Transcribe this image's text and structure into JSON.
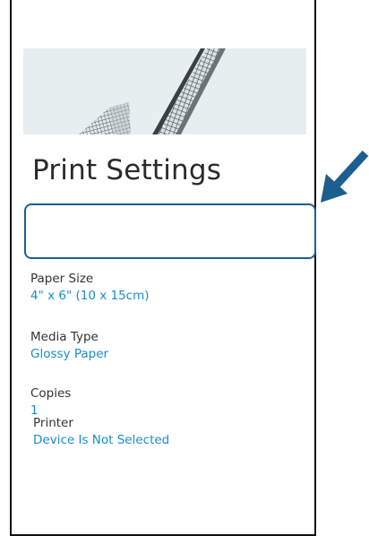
{
  "page": {
    "title": "Print Settings"
  },
  "settings": [
    {
      "label": "Printer",
      "value": "Device Is Not Selected"
    },
    {
      "label": "Paper Size",
      "value": "4\" x 6\" (10 x 15cm)"
    },
    {
      "label": "Media Type",
      "value": "Glossy Paper"
    },
    {
      "label": "Copies",
      "value": "1"
    }
  ],
  "colors": {
    "accent_value": "#1a8cc9",
    "highlight_border": "#1c5f8f",
    "callout_arrow": "#1c5f8f",
    "title_text": "#2a2a2a"
  },
  "icons": {
    "callout": "arrow-pointing-down-left-icon"
  }
}
